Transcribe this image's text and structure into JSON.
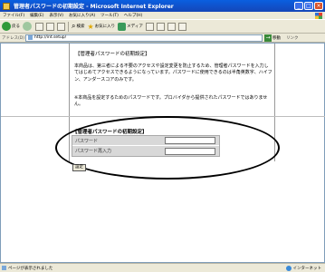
{
  "window": {
    "title": "管理者パスワードの初期設定 - Microsoft Internet Explorer",
    "controls": [
      "_",
      "□",
      "×"
    ]
  },
  "menubar": {
    "items": [
      "ファイル(F)",
      "編集(E)",
      "表示(V)",
      "お気に入り(A)",
      "ツール(T)",
      "ヘルプ(H)"
    ]
  },
  "toolbar": {
    "back_label": "戻る",
    "search_label": "検索",
    "favorites_label": "お気に入り",
    "media_label": "メディア"
  },
  "addressbar": {
    "label": "アドレス(D)",
    "url": "http://int.setup/",
    "go_label": "移動",
    "links_label": "リンク"
  },
  "page": {
    "title": "【管理者パスワードの初期設定】",
    "notice_p1": "本商品は、第三者による不要のアクセスや設定変更を防止するため、管理者パスワードを入力してはじめてアクセスできるようになっています。パスワードに使用できるのは半角英数字、ハイフン、アンダースコアのみです。",
    "notice_p2": "※本商品を設定するためのパスワードです。プロバイダから提供されたパスワードではありません。",
    "form_title": "【管理者パスワードの初期設定】",
    "password_label": "パスワード",
    "password_confirm_label": "パスワード再入力",
    "set_button": "設定"
  },
  "statusbar": {
    "text": "ページが表示されました",
    "zone": "インターネット"
  }
}
